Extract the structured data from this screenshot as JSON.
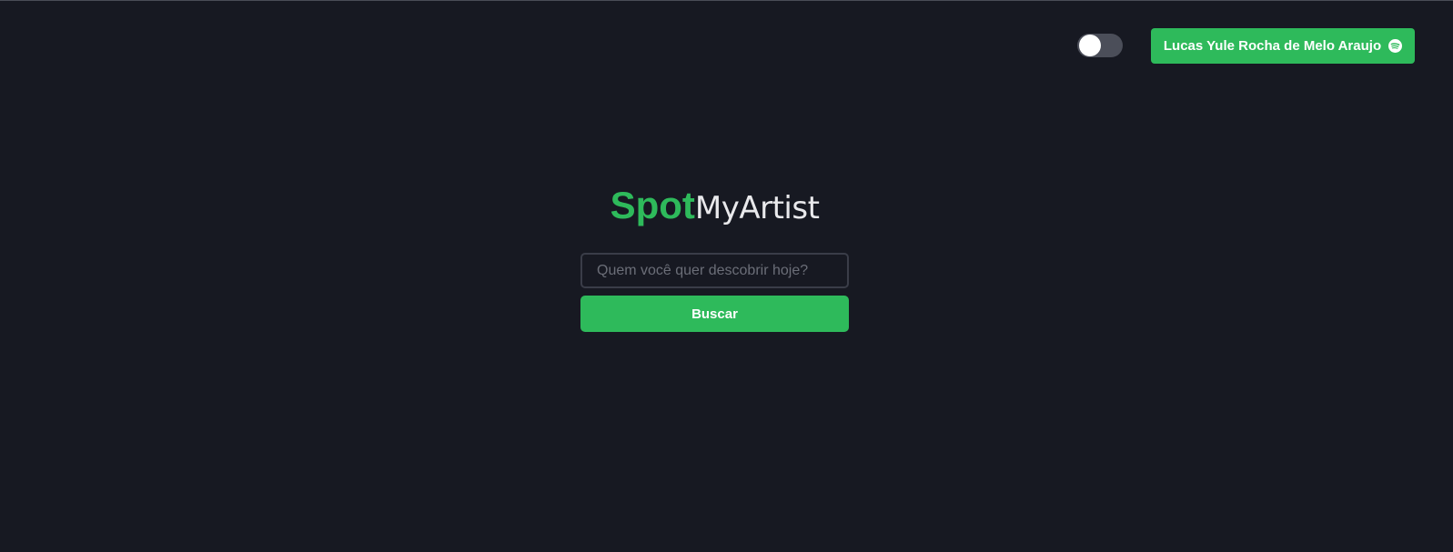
{
  "header": {
    "theme_toggle": {
      "state": "off"
    },
    "user_button": {
      "label": "Lucas Yule Rocha de Melo Araujo",
      "icon": "spotify-icon"
    }
  },
  "logo": {
    "part_bold": "Spot",
    "part_light": "MyArtist"
  },
  "search": {
    "placeholder": "Quem você quer descobrir hoje?",
    "value": "",
    "button_label": "Buscar"
  },
  "colors": {
    "background": "#171922",
    "accent": "#2eba5b",
    "text_light": "#e9e9ec",
    "input_border": "#3a3d48"
  }
}
